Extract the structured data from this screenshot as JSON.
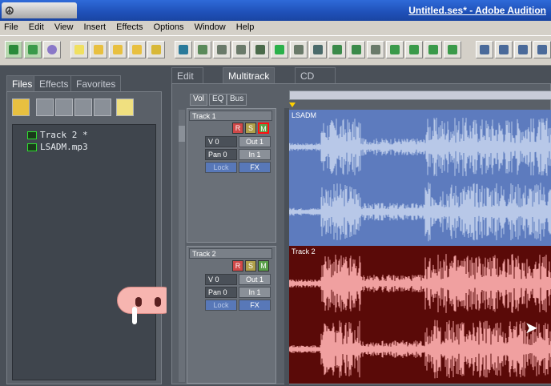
{
  "app": {
    "title": "Untitled.ses* - Adobe Audition"
  },
  "menu": [
    "File",
    "Edit",
    "View",
    "Insert",
    "Effects",
    "Options",
    "Window",
    "Help"
  ],
  "left_tabs": [
    "Files",
    "Effects",
    "Favorites"
  ],
  "files": [
    "Track 2 *",
    "LSADM.mp3"
  ],
  "view_tabs": [
    "Edit View",
    "Multitrack View",
    "CD Project View"
  ],
  "sub_tabs": [
    "Vol",
    "EQ",
    "Bus"
  ],
  "tracks": [
    {
      "name": "Track 1",
      "r": "R",
      "s": "S",
      "m": "M",
      "volume": "V 0",
      "pan": "Pan 0",
      "out": "Out 1",
      "in": "In 1",
      "lock": "Lock",
      "fx": "FX",
      "clip_label": "LSADM"
    },
    {
      "name": "Track 2",
      "r": "R",
      "s": "S",
      "m": "M",
      "volume": "V 0",
      "pan": "Pan 0",
      "out": "Out 1",
      "in": "In 1",
      "lock": "Lock",
      "fx": "FX",
      "clip_label": "Track 2"
    }
  ],
  "colors": {
    "accent": "#1f50b8",
    "track1_clip": "#5d7bbe",
    "track1_wave": "#b8c8e8",
    "track2_clip": "#5a0a08",
    "track2_wave": "#f0a0a0"
  }
}
